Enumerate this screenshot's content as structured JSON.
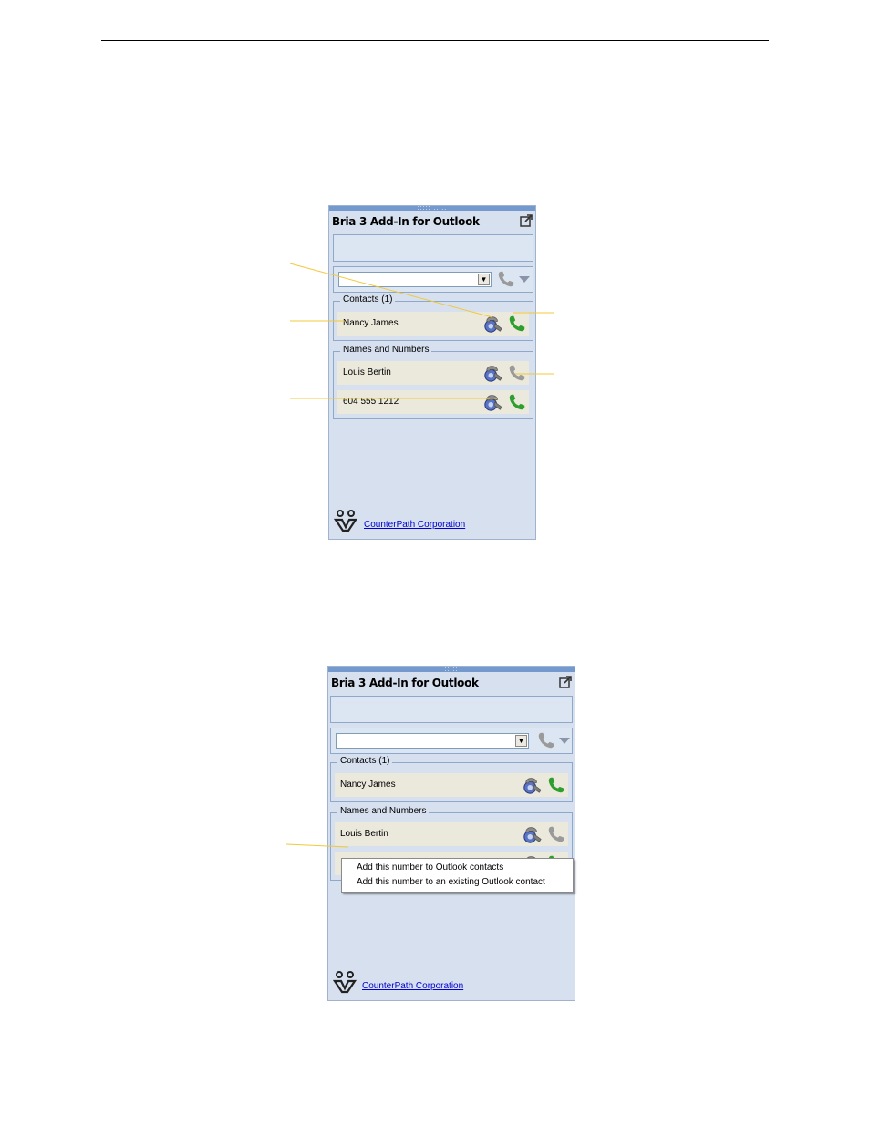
{
  "screenshot_a": {
    "title": "Bria 3 Add-In for Outlook",
    "dial_input_value": "",
    "contacts_group_label": "Contacts (1)",
    "contacts": [
      "Nancy James"
    ],
    "names_group_label": "Names and Numbers",
    "names": [
      "Louis Bertin",
      "604 555 1212"
    ],
    "footer_link": "CounterPath Corporation"
  },
  "screenshot_b": {
    "title": "Bria 3 Add-In for Outlook",
    "dial_input_value": "",
    "contacts_group_label": "Contacts (1)",
    "contacts": [
      "Nancy James"
    ],
    "names_group_label": "Names and Numbers",
    "names": [
      "Louis Bertin"
    ],
    "footer_link": "CounterPath Corporation",
    "context_menu": [
      "Add this number to Outlook contacts",
      "Add this number to an existing Outlook contact"
    ]
  },
  "icons": {
    "popout": "popout-icon",
    "phone": "phone-icon",
    "dropdown": "dropdown-arrow-icon",
    "video": "video-call-icon",
    "logo": "counterpath-logo-icon"
  },
  "colors": {
    "panel_bg": "#d6e0ef",
    "panel_topbar": "#7399cf",
    "row_bg": "#ebe8dc",
    "callout_line": "#f2c83a",
    "phone_green": "#2e9e2e",
    "phone_gray": "#8c8c8c",
    "link": "#0000cc"
  }
}
